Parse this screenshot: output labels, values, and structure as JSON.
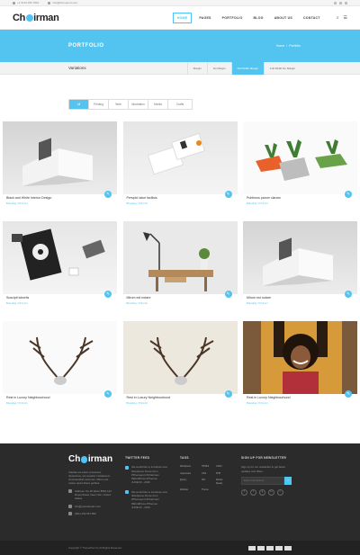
{
  "topbar": {
    "phone": "+1 0123 456 7891",
    "email": "info@themeport.com"
  },
  "header": {
    "logo": {
      "pre": "Ch",
      "post": "irman"
    },
    "nav": [
      "HOME",
      "PAGES",
      "PORTFOLIO",
      "BLOG",
      "ABOUT US",
      "CONTACT"
    ]
  },
  "title": {
    "heading": "PORTFOLIO",
    "crumb_home": "Home",
    "crumb_sep": "/",
    "crumb_current": "Portfolio"
  },
  "variations": {
    "label": "Variations",
    "tabs": [
      "Margin",
      "No Margin",
      "Full Width Margin",
      "Full Width No Margin"
    ]
  },
  "filters": [
    "All",
    "Printing",
    "Web",
    "Illustration",
    "Media",
    "Crafts"
  ],
  "cards": [
    {
      "title": "Black and White Interior Design",
      "cats": "Branding / Print Art"
    },
    {
      "title": "Perspici iatue facilisis",
      "cats": "Branding / Print Art"
    },
    {
      "title": "Publimus parum claram",
      "cats": "Branding / Print Art"
    },
    {
      "title": "Suscipit lobortis",
      "cats": "Branding / Print Art"
    },
    {
      "title": "Mirum est notare",
      "cats": "Branding / Print Art"
    },
    {
      "title": "Mirum est notare",
      "cats": "Branding / Print Art"
    },
    {
      "title": "Rest in Luxury Neighbourhood",
      "cats": "Branding / Print Art"
    },
    {
      "title": "Rest in Luxury Neighbourhood",
      "cats": "Branding / Print Art"
    },
    {
      "title": "Rest in Luxury Neighbourhood",
      "cats": "Branding / Print Art"
    }
  ],
  "footer": {
    "about": "Claritas est etiam processus dynamicus, qui sequitur mutationem consuetudium lectorum. Mirum est notare quam littera gothica.",
    "address": "Address: No 90 Wesc 8654 124 Royal Street, New York, United States",
    "email": "info@yourdomain.com",
    "phone": "(001) 234 567 890",
    "twitter_heading": "TWITTER FEED",
    "tweets": [
      {
        "text": "We would like to introduce new Wordpress theme from #Themeport #Chairman #WordPress #Themes",
        "date": "JUNE 03 - 2016"
      },
      {
        "text": "We would like to introduce new Wordpress theme from #Themeport #Chairman #WordPress #Themes",
        "date": "JUNE 03 - 2016"
      }
    ],
    "tags_heading": "TAGS",
    "tags": [
      "Wordpress",
      "HTML5",
      "CSS3",
      "responsive",
      "CSS",
      "PHP",
      "jQuery",
      "API",
      "Retina Ready",
      "Website",
      "Theme"
    ],
    "nl_heading": "SIGN UP FOR NEWSLETTER",
    "nl_text": "Sign up for our newsletter to get latest updates and offers.",
    "nl_placeholder": "Enter email address...",
    "copyright": "Copyright © ThemePort.Co All Rights Reserved."
  }
}
